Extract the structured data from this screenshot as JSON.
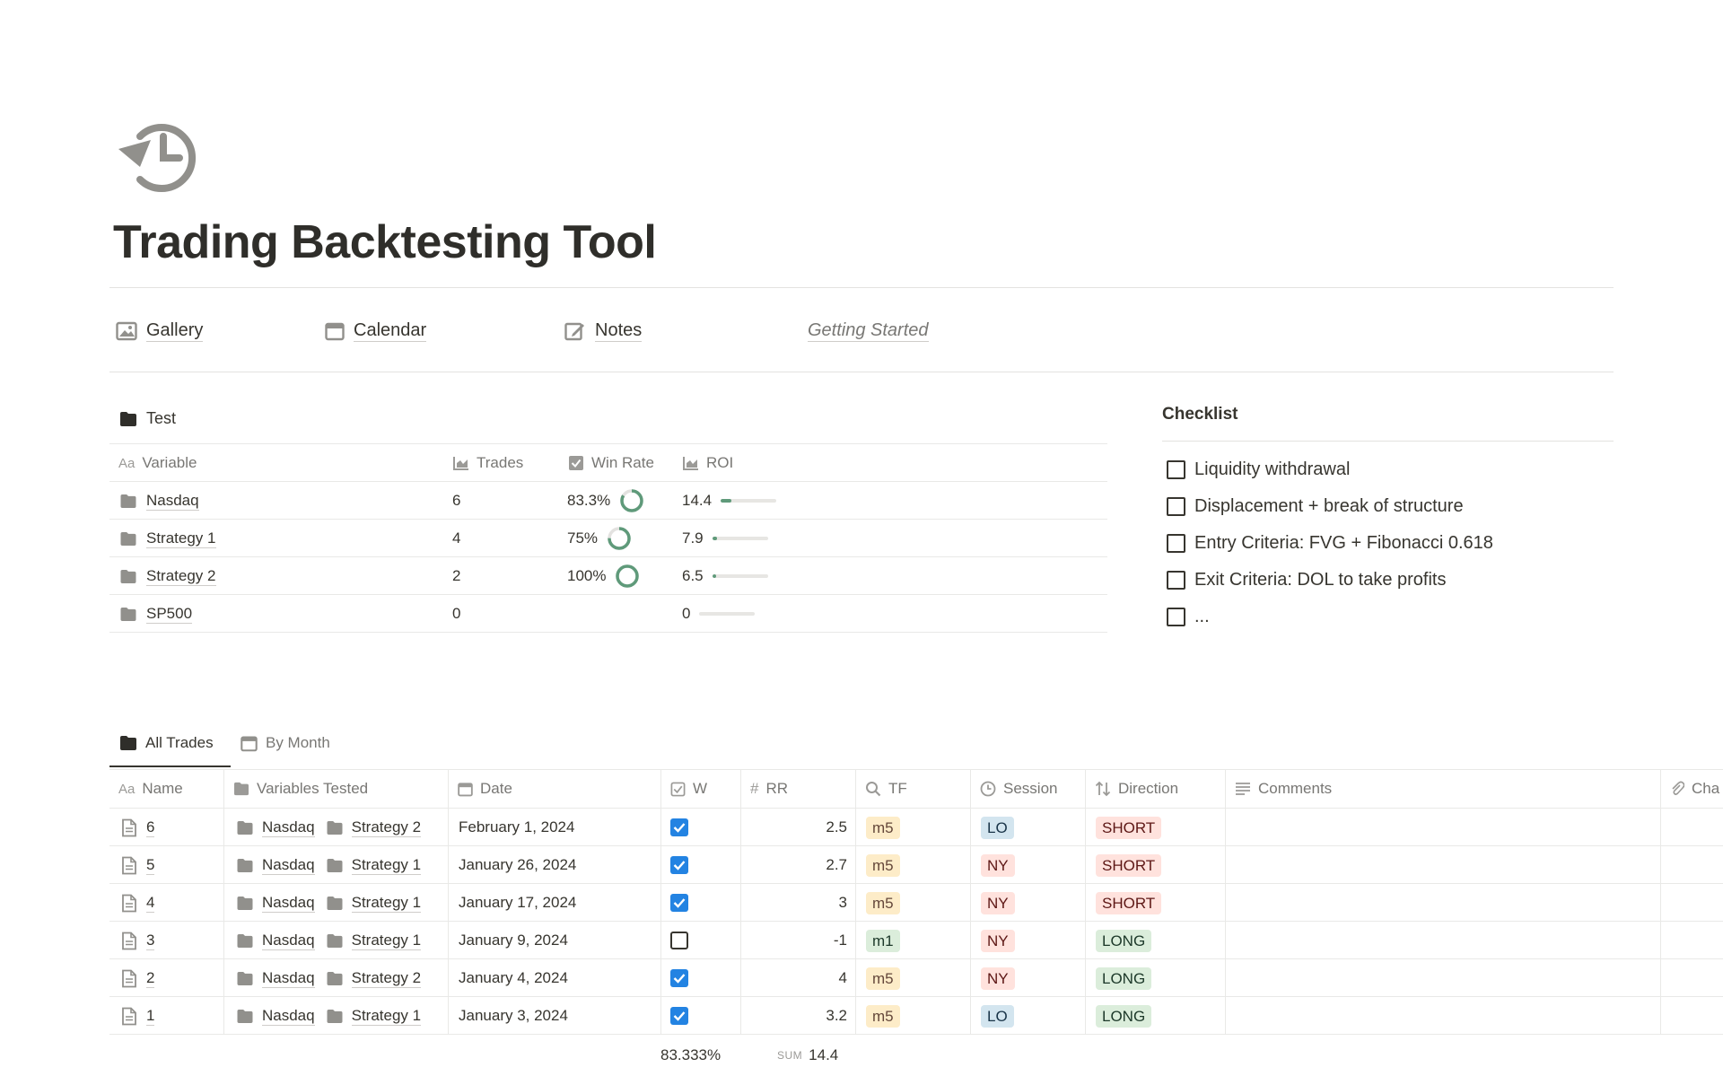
{
  "page": {
    "title": "Trading Backtesting Tool",
    "icon": "history-icon"
  },
  "nav": [
    {
      "label": "Gallery",
      "icon": "image-icon"
    },
    {
      "label": "Calendar",
      "icon": "calendar-icon"
    },
    {
      "label": "Notes",
      "icon": "edit-icon"
    },
    {
      "label": "Getting Started",
      "icon": ""
    }
  ],
  "test_db": {
    "title": "Test",
    "columns": [
      "Variable",
      "Trades",
      "Win Rate",
      "ROI"
    ],
    "rows": [
      {
        "variable": "Nasdaq",
        "trades": "6",
        "win_rate": "83.3%",
        "win_rate_value": 0.833,
        "roi": "14.4",
        "roi_fraction": 0.2
      },
      {
        "variable": "Strategy 1",
        "trades": "4",
        "win_rate": "75%",
        "win_rate_value": 0.75,
        "roi": "7.9",
        "roi_fraction": 0.08
      },
      {
        "variable": "Strategy 2",
        "trades": "2",
        "win_rate": "100%",
        "win_rate_value": 1.0,
        "roi": "6.5",
        "roi_fraction": 0.07
      },
      {
        "variable": "SP500",
        "trades": "0",
        "win_rate": "",
        "win_rate_value": 0,
        "roi": "0",
        "roi_fraction": 0
      }
    ]
  },
  "checklist": {
    "title": "Checklist",
    "items": [
      "Liquidity withdrawal",
      "Displacement + break of structure",
      "Entry Criteria: FVG + Fibonacci 0.618",
      "Exit Criteria: DOL to take profits",
      "..."
    ]
  },
  "trades_db": {
    "tabs": [
      "All Trades",
      "By Month"
    ],
    "columns": [
      "Name",
      "Variables Tested",
      "Date",
      "W",
      "RR",
      "TF",
      "Session",
      "Direction",
      "Comments",
      "Cha"
    ],
    "rows": [
      {
        "name": "6",
        "var1": "Nasdaq",
        "var2": "Strategy 2",
        "date": "February 1, 2024",
        "w": true,
        "rr": "2.5",
        "tf": "m5",
        "session": "LO",
        "direction": "SHORT"
      },
      {
        "name": "5",
        "var1": "Nasdaq",
        "var2": "Strategy 1",
        "date": "January 26, 2024",
        "w": true,
        "rr": "2.7",
        "tf": "m5",
        "session": "NY",
        "direction": "SHORT"
      },
      {
        "name": "4",
        "var1": "Nasdaq",
        "var2": "Strategy 1",
        "date": "January 17, 2024",
        "w": true,
        "rr": "3",
        "tf": "m5",
        "session": "NY",
        "direction": "SHORT"
      },
      {
        "name": "3",
        "var1": "Nasdaq",
        "var2": "Strategy 1",
        "date": "January 9, 2024",
        "w": false,
        "rr": "-1",
        "tf": "m1",
        "session": "NY",
        "direction": "LONG"
      },
      {
        "name": "2",
        "var1": "Nasdaq",
        "var2": "Strategy 2",
        "date": "January 4, 2024",
        "w": true,
        "rr": "4",
        "tf": "m5",
        "session": "NY",
        "direction": "LONG"
      },
      {
        "name": "1",
        "var1": "Nasdaq",
        "var2": "Strategy 1",
        "date": "January 3, 2024",
        "w": true,
        "rr": "3.2",
        "tf": "m5",
        "session": "LO",
        "direction": "LONG"
      }
    ],
    "footer": {
      "w_pct": "83.333%",
      "sum_label": "SUM",
      "rr_sum": "14.4"
    }
  },
  "colors": {
    "tag_m5_bg": "#fdecc8",
    "tag_m5_fg": "#64473a",
    "tag_m1_bg": "#dbeddb",
    "tag_m1_fg": "#1c3829",
    "tag_lo_bg": "#d3e5ef",
    "tag_lo_fg": "#183347",
    "tag_ny_bg": "#ffe2dd",
    "tag_ny_fg": "#5d1715",
    "tag_short_bg": "#ffe2dd",
    "tag_short_fg": "#5d1715",
    "tag_long_bg": "#dbeddb",
    "tag_long_fg": "#1c3829",
    "accent_green": "#5f9a7a",
    "checkbox_blue": "#2383e2"
  }
}
